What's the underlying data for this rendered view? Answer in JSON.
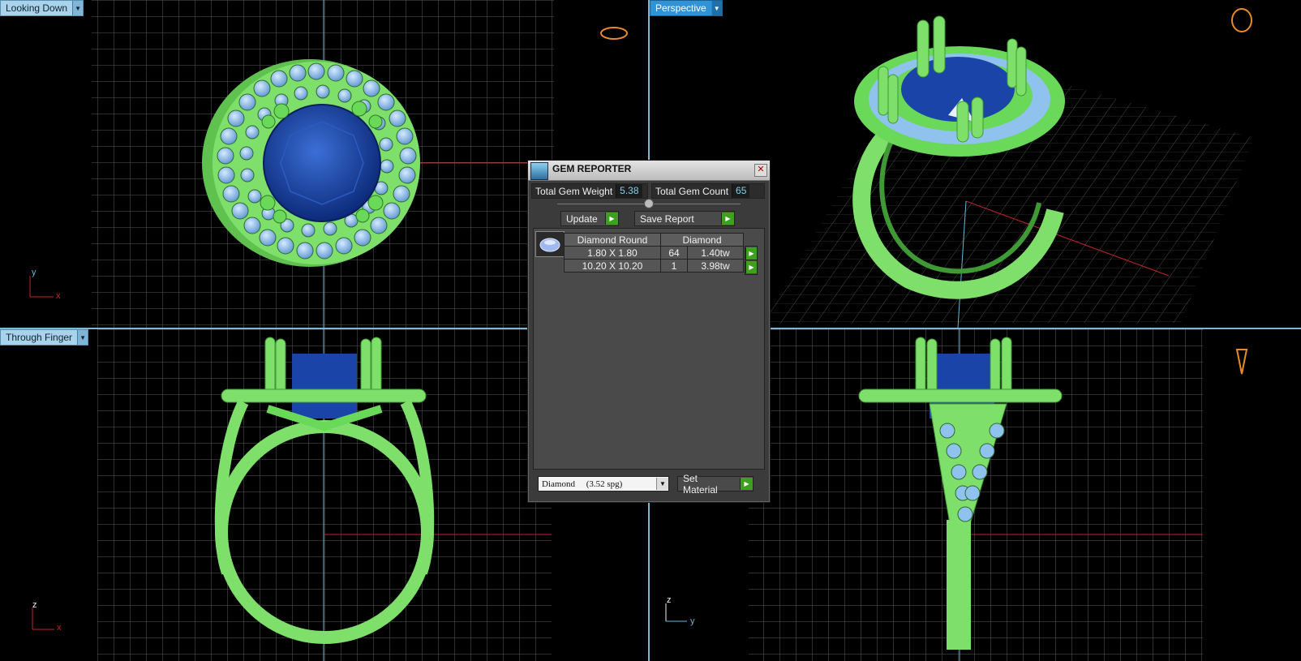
{
  "viewports": {
    "top_left": {
      "label": "Looking Down"
    },
    "top_right": {
      "label": "Perspective"
    },
    "bottom_left": {
      "label": "Through Finger"
    }
  },
  "axes": {
    "top_left": {
      "a": "y",
      "b": "x"
    },
    "bottom_left": {
      "a": "z",
      "b": "x"
    },
    "bottom_right": {
      "a": "z",
      "b": "y"
    }
  },
  "gem_reporter": {
    "title": "GEM REPORTER",
    "total_weight_label": "Total Gem Weight",
    "total_weight": "5.38",
    "total_count_label": "Total Gem Count",
    "total_count": "65",
    "update_label": "Update",
    "save_label": "Save Report",
    "table": {
      "headers": [
        "Diamond Round",
        "Diamond"
      ],
      "rows": [
        {
          "size": "1.80 X 1.80",
          "count": "64",
          "weight": "1.40tw"
        },
        {
          "size": "10.20 X 10.20",
          "count": "1",
          "weight": "3.98tw"
        }
      ]
    },
    "material": "Diamond     (3.52 spg)",
    "set_material_label": "Set Material"
  },
  "colors": {
    "ring": "#7ee06a",
    "ring_dark": "#3f9a36",
    "center_stone": "#1b44a8",
    "accent_stones": "#8fc3ee",
    "grid": "#6a6a6a",
    "x_axis": "#c0252a",
    "y_axis": "#6ab8d8"
  }
}
